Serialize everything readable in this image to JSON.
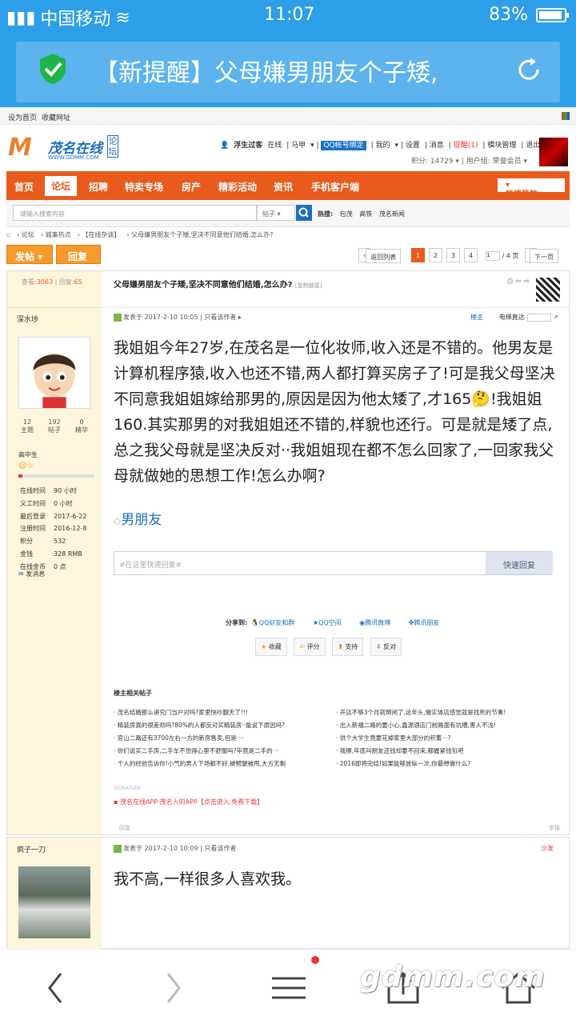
{
  "status": {
    "carrier": "中国移动",
    "network": "4G",
    "time": "11:07",
    "battery": "83%",
    "battery_level": 0.83
  },
  "app": {
    "notice": "【新提醒】父母嫌男朋友个子矮,"
  },
  "topnav": {
    "home": "设为首页",
    "fav": "收藏网址"
  },
  "site": {
    "logo_m": "M",
    "logo_text": "茂名在线",
    "logo_url": "WWW.GDMM.COM",
    "logo_tag": "论坛"
  },
  "user": {
    "name": "浮生过客",
    "online": "在线",
    "horse": "马甲",
    "qq": "QQ帐号绑定",
    "my": "我的",
    "settings": "设置",
    "msg": "消息",
    "remind": "提醒(1)",
    "modules": "模块管理",
    "logout": "退出",
    "points": "积分: 14729",
    "group": "用户组: 荣誉会员"
  },
  "mainnav": {
    "items": [
      "首页",
      "论坛",
      "招聘",
      "特卖专场",
      "房产",
      "精彩活动",
      "资讯",
      "手机客户端"
    ],
    "guide": "快捷导航"
  },
  "search": {
    "placeholder": "请输入搜索内容",
    "type": "帖子",
    "hot_label": "热搜:",
    "hot": [
      "包茂",
      "高铁",
      "茂名新闻"
    ]
  },
  "crumb": {
    "items": [
      "论坛",
      "城事热点",
      "【在线杂谈】",
      "父母嫌男朋友个子矮,坚决不同意他们结婚,怎么办?"
    ]
  },
  "actions": {
    "post": "发帖",
    "reply": "回复"
  },
  "pager": {
    "back": "返回列表",
    "pages": [
      "1",
      "2",
      "3",
      "4"
    ],
    "input": "1",
    "total": "/ 4 页",
    "next": "下一页"
  },
  "post": {
    "views_label": "查看:",
    "views": "3063",
    "replies_label": "回复:",
    "replies": "65",
    "title": "父母嫌男朋友个子矮,坚决不同意他们结婚,怎么办?",
    "copy_link": "[复制链接]",
    "author": "深水埗",
    "stats": [
      {
        "n": "12",
        "l": "主题"
      },
      {
        "n": "192",
        "l": "帖子"
      },
      {
        "n": "0",
        "l": "精华"
      }
    ],
    "level": "高中生",
    "level_progress": 0.05,
    "info": [
      [
        "在线时间",
        "90 小时"
      ],
      [
        "义工时间",
        "0 小时"
      ],
      [
        "最后登录",
        "2017-6-22"
      ],
      [
        "注册时间",
        "2016-12-8"
      ],
      [
        "积分",
        "532"
      ],
      [
        "金钱",
        "328 RMB"
      ],
      [
        "在线金币",
        "0 点"
      ]
    ],
    "pm": "发消息",
    "time": "发表于 2017-2-10 10:05",
    "only_author": "只看该作者",
    "owner": "楼主",
    "elevator": "电梯直达",
    "body": "我姐姐今年27岁,在茂名是一位化妆师,收入还是不错的。他男友是计算机程序猿,收入也还不错,两人都打算买房子了!可是我父母坚决不同意我姐姐嫁给那男的,原因是因为他太矮了,才165🤔!我姐姐160.其实那男的对我姐姐还不错的,样貌也还行。可是就是矮了点,总之我父母就是坚决反对··我姐姐现在都不怎么回家了,一回家我父母就做她的思想工作!怎么办啊?",
    "tag": "男朋友",
    "quick_reply_placeholder": "#在这里快速回复#",
    "quick_reply_btn": "快速回复",
    "share_label": "分享到:",
    "share": [
      "QQ好友和群",
      "QQ空间",
      "腾讯微博",
      "腾讯朋友"
    ],
    "rate": [
      "收藏",
      "评分",
      "支持",
      "反对"
    ],
    "related_title": "楼主相关帖子",
    "related": [
      "· 茂名结婚那么讲究门当户对吗?家里快吵翻天了!!!",
      "· 开店不够3个月就倒闭了,这年头,做实体店感觉就是找死的节奏!",
      "· 精装房真的很差劲吗?80%的人都反对买精装房··能说下原因吗?",
      "· 出入新福二路的要小心,鑫源酒店门前路面有坑槽,害人不浅!",
      "· 官山二路还有3700左右一方的新房售卖,但是····",
      "· 供个大学生竟要花掉家里大部分的积蓄···?",
      "· 你们说买二手房,二手车不觉得心里不舒服吗?毕竟是二手的···",
      "· 我擦,年底叫朋友还钱却要不回来,都握紧钱包吧",
      "· 个人的经验告诉你!小气的男人下场都不好,被劈腿被甩,大方无剩",
      "· 2016即将完结!如果能够放纵一次,你最想做什么?"
    ],
    "signature": "SIGNATURE",
    "sig_link": "▪ 茂名在线APP·茂名人的APP【点击进入,免费下载】",
    "reply_link": "回复",
    "report": "举报"
  },
  "post2": {
    "author": "疯子一刀",
    "time": "发表于 2017-2-10 10:09",
    "only_author": "只看该作者",
    "floor": "沙发",
    "body": "我不高,一样很多人喜欢我。"
  },
  "watermark": "gdmm.com"
}
